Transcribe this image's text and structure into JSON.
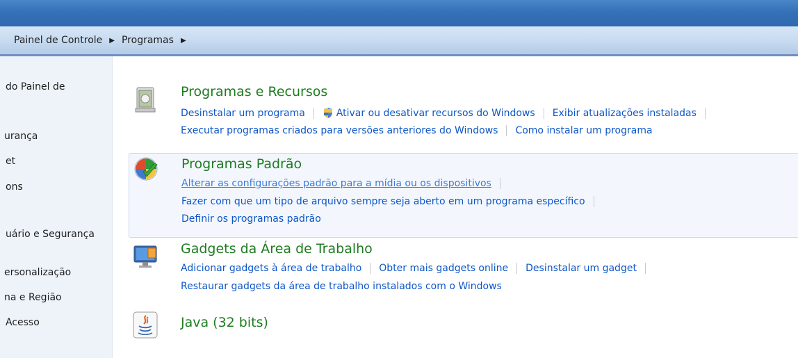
{
  "breadcrumb": {
    "item1": "Painel de Controle",
    "item2": "Programas"
  },
  "sidebar": {
    "items": [
      "do Painel de",
      "urança",
      "et",
      "ons",
      "uário e Segurança",
      "ersonalização",
      "na e Região",
      "Acesso"
    ]
  },
  "sections": {
    "programs": {
      "title": "Programas e Recursos",
      "links": {
        "uninstall": "Desinstalar um programa",
        "features": "Ativar ou desativar recursos do Windows",
        "updates": "Exibir atualizações instaladas",
        "compat": "Executar programas criados para versões anteriores do Windows",
        "howto": "Como instalar um programa"
      }
    },
    "defaults": {
      "title": "Programas Padrão",
      "links": {
        "autoplay": "Alterar as configurações padrão para a mídia ou os dispositivos",
        "assoc": "Fazer com que um tipo de arquivo sempre seja aberto em um programa específico",
        "setdefaults": "Definir os programas padrão"
      }
    },
    "gadgets": {
      "title": "Gadgets da Área de Trabalho",
      "links": {
        "add": "Adicionar gadgets à área de trabalho",
        "more": "Obter mais gadgets online",
        "uninstall": "Desinstalar um gadget",
        "restore": "Restaurar gadgets da área de trabalho instalados com o Windows"
      }
    },
    "java": {
      "title": "Java (32 bits)"
    }
  },
  "colors": {
    "title_green": "#1e7c20",
    "link_blue": "#0d56c7",
    "titlebar_blue": "#3571b8"
  }
}
